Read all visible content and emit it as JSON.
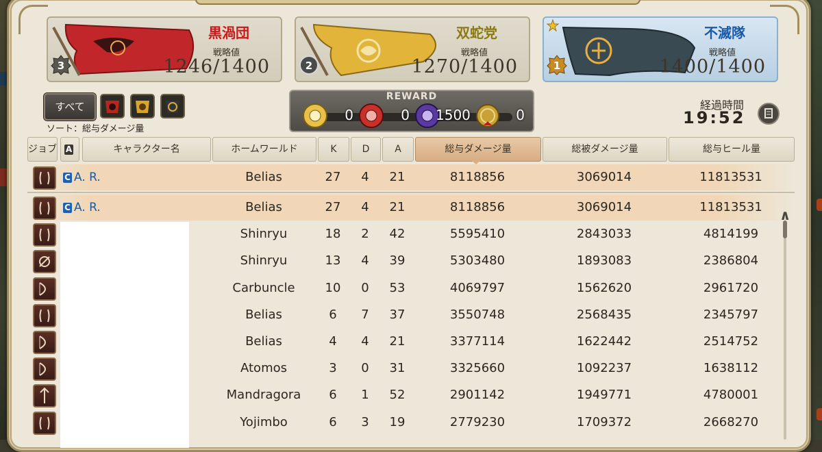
{
  "teams": [
    {
      "name": "黒渦団",
      "name_color": "#c81818",
      "stat_label": "戦略値",
      "score": "1246/1400",
      "rank": "3",
      "banner_color": "#c0262a"
    },
    {
      "name": "双蛇党",
      "name_color": "#8a7a10",
      "stat_label": "戦略値",
      "score": "1270/1400",
      "rank": "2",
      "banner_color": "#e2b53a"
    },
    {
      "name": "不滅隊",
      "name_color": "#1b5aa6",
      "stat_label": "戦略値",
      "score": "1400/1400",
      "rank": "1",
      "banner_color": "#3a4a52"
    }
  ],
  "filters": {
    "all_label": "すべて",
    "icons": [
      "maelstrom-filter-icon",
      "twin-adder-filter-icon",
      "immortal-flames-filter-icon"
    ]
  },
  "sort_label": "ソート：総与ダメージ量",
  "reward": {
    "title": "REWARD",
    "items": [
      {
        "icon": "gold-medal-icon",
        "value": "0"
      },
      {
        "icon": "red-medal-icon",
        "value": "0"
      },
      {
        "icon": "purple-medal-icon",
        "value": "1500"
      },
      {
        "icon": "coin-icon",
        "value": "0"
      }
    ]
  },
  "elapsed": {
    "label": "経過時間",
    "time": "19:52"
  },
  "columns": {
    "job": "ジョブ",
    "a": "A",
    "name": "キャラクター名",
    "world": "ホームワールド",
    "k": "K",
    "d": "D",
    "assist": "A",
    "dmg": "総与ダメージ量",
    "taken": "総被ダメージ量",
    "heal": "総与ヒール量"
  },
  "pinned_row": {
    "name": "A. R.",
    "world": "Belias",
    "k": "27",
    "d": "4",
    "a": "21",
    "dmg": "8118856",
    "taken": "3069014",
    "heal": "11813531"
  },
  "rows": [
    {
      "name": "A. R.",
      "world": "Belias",
      "k": "27",
      "d": "4",
      "a": "21",
      "dmg": "8118856",
      "taken": "3069014",
      "heal": "11813531",
      "job_icon": "healer-job-icon"
    },
    {
      "name": "",
      "world": "Shinryu",
      "k": "18",
      "d": "2",
      "a": "42",
      "dmg": "5595410",
      "taken": "2843033",
      "heal": "4814199",
      "job_icon": "healer-job-icon"
    },
    {
      "name": "",
      "world": "Shinryu",
      "k": "13",
      "d": "4",
      "a": "39",
      "dmg": "5303480",
      "taken": "1893083",
      "heal": "2386804",
      "job_icon": "caster-job-icon"
    },
    {
      "name": "",
      "world": "Carbuncle",
      "k": "10",
      "d": "0",
      "a": "53",
      "dmg": "4069797",
      "taken": "1562620",
      "heal": "2961720",
      "job_icon": "bow-job-icon"
    },
    {
      "name": "",
      "world": "Belias",
      "k": "6",
      "d": "7",
      "a": "37",
      "dmg": "3550748",
      "taken": "2568435",
      "heal": "2345797",
      "job_icon": "healer-job-icon"
    },
    {
      "name": "",
      "world": "Belias",
      "k": "4",
      "d": "4",
      "a": "21",
      "dmg": "3377114",
      "taken": "1622442",
      "heal": "2514752",
      "job_icon": "bow-job-icon"
    },
    {
      "name": "",
      "world": "Atomos",
      "k": "3",
      "d": "0",
      "a": "31",
      "dmg": "3325660",
      "taken": "1092237",
      "heal": "1638112",
      "job_icon": "bow-job-icon"
    },
    {
      "name": "",
      "world": "Mandragora",
      "k": "6",
      "d": "1",
      "a": "52",
      "dmg": "2901142",
      "taken": "1949771",
      "heal": "4780001",
      "job_icon": "lance-job-icon"
    },
    {
      "name": "",
      "world": "Yojimbo",
      "k": "6",
      "d": "3",
      "a": "19",
      "dmg": "2779230",
      "taken": "1709372",
      "heal": "2668270",
      "job_icon": "healer-job-icon"
    }
  ]
}
